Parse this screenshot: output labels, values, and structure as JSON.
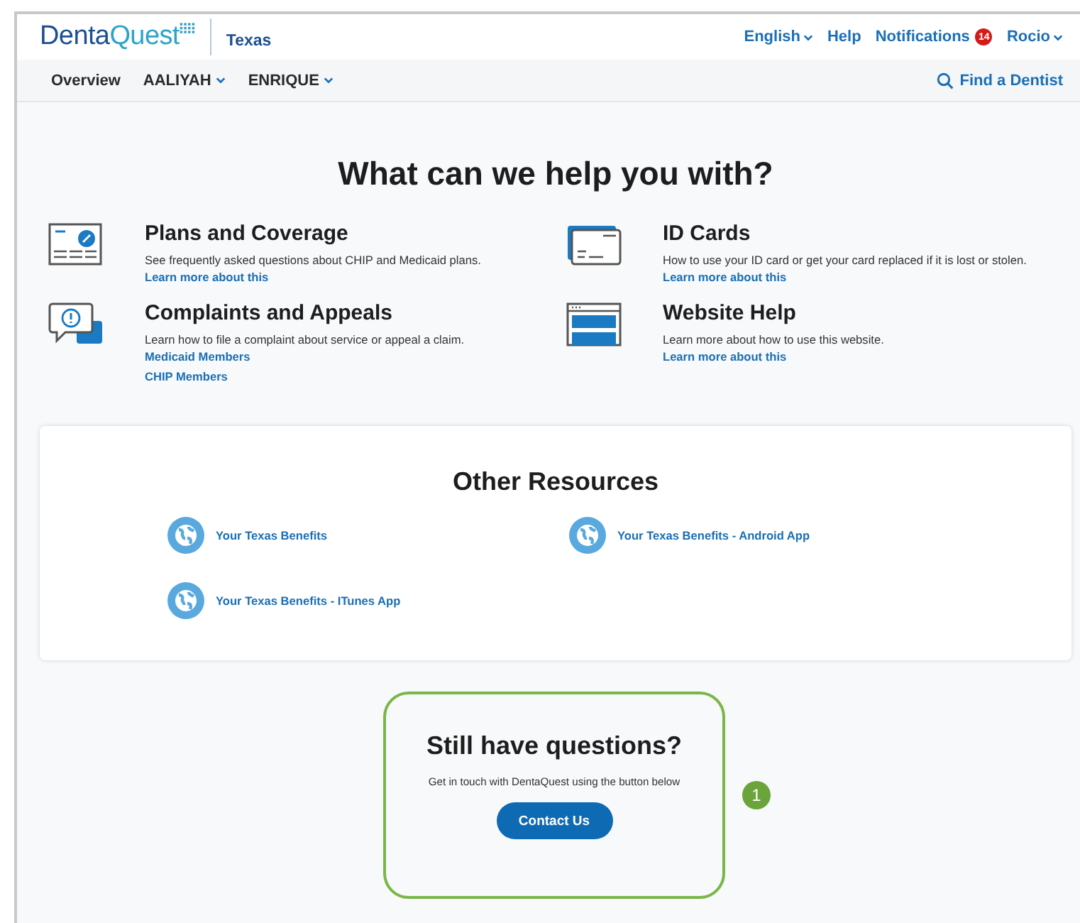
{
  "header": {
    "brand_primary": "Denta",
    "brand_accent": "Quest",
    "region": "Texas",
    "links": [
      {
        "label": "English",
        "dropdown": true
      },
      {
        "label": "Help",
        "dropdown": false
      },
      {
        "label": "Notifications",
        "dropdown": false,
        "badge": "14"
      },
      {
        "label": "Rocio",
        "dropdown": true
      }
    ]
  },
  "nav": {
    "items": [
      {
        "label": "Overview",
        "dropdown": false
      },
      {
        "label": "AALIYAH",
        "dropdown": true
      },
      {
        "label": "ENRIQUE",
        "dropdown": true
      }
    ],
    "find": "Find a Dentist"
  },
  "heading": "What can we help you with?",
  "topics": [
    {
      "kind": "plans",
      "title": "Plans and Coverage",
      "description": "See frequently asked questions about CHIP and Medicaid plans.",
      "links": [
        "Learn more about this"
      ]
    },
    {
      "kind": "id-card",
      "title": "ID Cards",
      "description": "How to use your ID card or get your card replaced if it is lost or stolen.",
      "links": [
        "Learn more about this"
      ]
    },
    {
      "kind": "complaints",
      "title": "Complaints and Appeals",
      "description": "Learn how to file a complaint about service or appeal a claim.",
      "links": [
        "Medicaid Members",
        "CHIP Members"
      ]
    },
    {
      "kind": "website",
      "title": "Website Help",
      "description": "Learn more about how to use this website.",
      "links": [
        "Learn more about this"
      ]
    }
  ],
  "resources": {
    "title": "Other Resources",
    "links": [
      "Your Texas Benefits",
      "Your Texas Benefits - Android App",
      "Your Texas Benefits - ITunes App"
    ]
  },
  "questions": {
    "title": "Still have questions?",
    "text": "Get in touch with DentaQuest using the button below",
    "button": "Contact Us",
    "marker": "1"
  }
}
